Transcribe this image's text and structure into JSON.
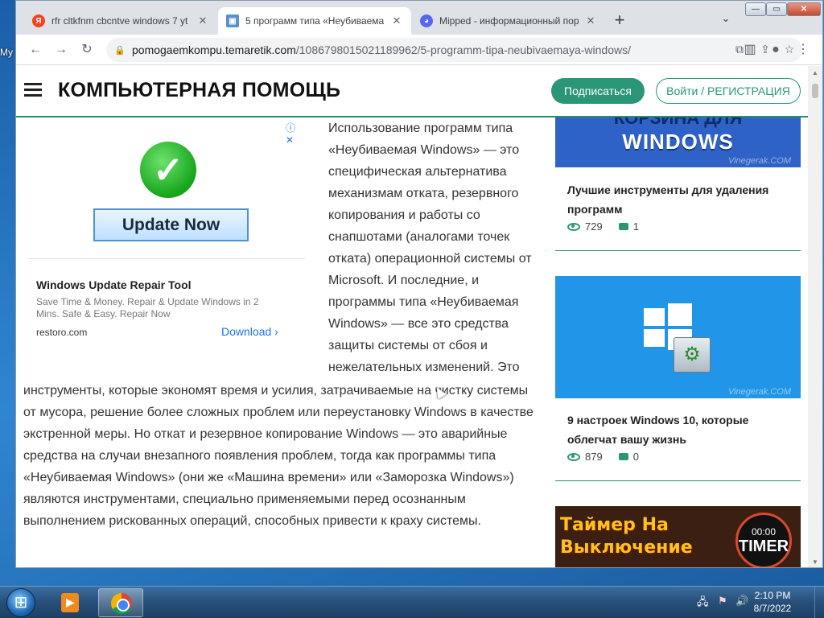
{
  "desktop": {
    "label": "My"
  },
  "tabs": [
    {
      "favicon": "yandex-icon",
      "favicon_color": "#fc3f1d",
      "favicon_glyph": "Я",
      "title": "rfr cltkfnm cbcntve windows 7 yt",
      "close": "✕",
      "active": false
    },
    {
      "favicon": "site-icon",
      "favicon_color": "#5a8fcf",
      "favicon_glyph": "▣",
      "title": "5 программ типа «Неубиваема",
      "close": "✕",
      "active": true
    },
    {
      "favicon": "discord-icon",
      "favicon_color": "#5865f2",
      "favicon_glyph": "◕",
      "title": "Mipped - информационный пор",
      "close": "✕",
      "active": false
    }
  ],
  "tabstrip": {
    "new_tab": "+",
    "tab_search": "⌄"
  },
  "window_controls": {
    "minimize": "—",
    "maximize": "▭",
    "close": "✕"
  },
  "toolbar": {
    "back": "←",
    "forward": "→",
    "reload": "↻",
    "url_domain": "pomogaemkompu.temaretik.com",
    "url_path": "/1086798015021189962/5-programm-tipa-neubivaemaya-windows/",
    "translate": "⧉",
    "share": "⇪",
    "bookmark": "☆",
    "side_panel": "▥",
    "profile": "●",
    "menu": "⋮"
  },
  "site": {
    "title": "КОМПЬЮТЕРНАЯ ПОМОЩЬ",
    "subscribe": "Подписаться",
    "login": "Войти / РЕГИСТРАЦИЯ",
    "accent_color": "#2a9677"
  },
  "ad": {
    "corner": "ⓘ ✕",
    "check": "✓",
    "button": "Update Now",
    "title": "Windows Update Repair Tool",
    "description": "Save Time & Money. Repair & Update Windows in 2 Mins. Safe & Easy. Repair Now",
    "domain": "restoro.com",
    "cta": "Download ›"
  },
  "article": {
    "side_text": "Использование программ типа «Неубиваемая Windows» — это специфическая альтернатива механизмам отката, резервного копирования и работы со снапшотами (аналогами точек отката) операционной системы от Microsoft. И последние, и программы типа «Неубиваемая Windows» — все это средства защиты системы от сбоя и нежелательных изменений. Это",
    "full_text": "инструменты, которые экономят время и усилия, затрачиваемые на чистку системы от мусора, решение более сложных проблем или переустановку Windows в качестве экстренной меры. Но откат и резервное копирование Windows — это аварийные средства на случаи внезапного появления проблем, тогда как программы типа «Неубиваемая Windows» (они же «Машина времени» или «Заморозка Windows») являются инструментами, специально применяемыми перед осознанным выполнением рискованных операций, способных привести к краху системы."
  },
  "sidebar": {
    "cards": [
      {
        "image_text_top": "КОРЗИНА ДЛЯ",
        "image_text": "WINDOWS",
        "watermark": "Vinegerak.COM",
        "title": "Лучшие инструменты для удаления программ",
        "views": "729",
        "comments": "1"
      },
      {
        "image_icon": "windows-settings-icon",
        "watermark": "Vinegerak.COM",
        "title": "9 настроек Windows 10, которые облегчат вашу жизнь",
        "views": "879",
        "comments": "0"
      },
      {
        "image_text": "Таймер На Выключение",
        "timer_small": "00:00",
        "timer_big": "TIMER"
      }
    ]
  },
  "taskbar": {
    "clock_time": "2:10 PM",
    "clock_date": "8/7/2022",
    "tray_icons": [
      "network-icon",
      "flag-icon",
      "volume-icon"
    ],
    "tray_glyphs": [
      "🖧",
      "⚑",
      "🔊"
    ]
  }
}
